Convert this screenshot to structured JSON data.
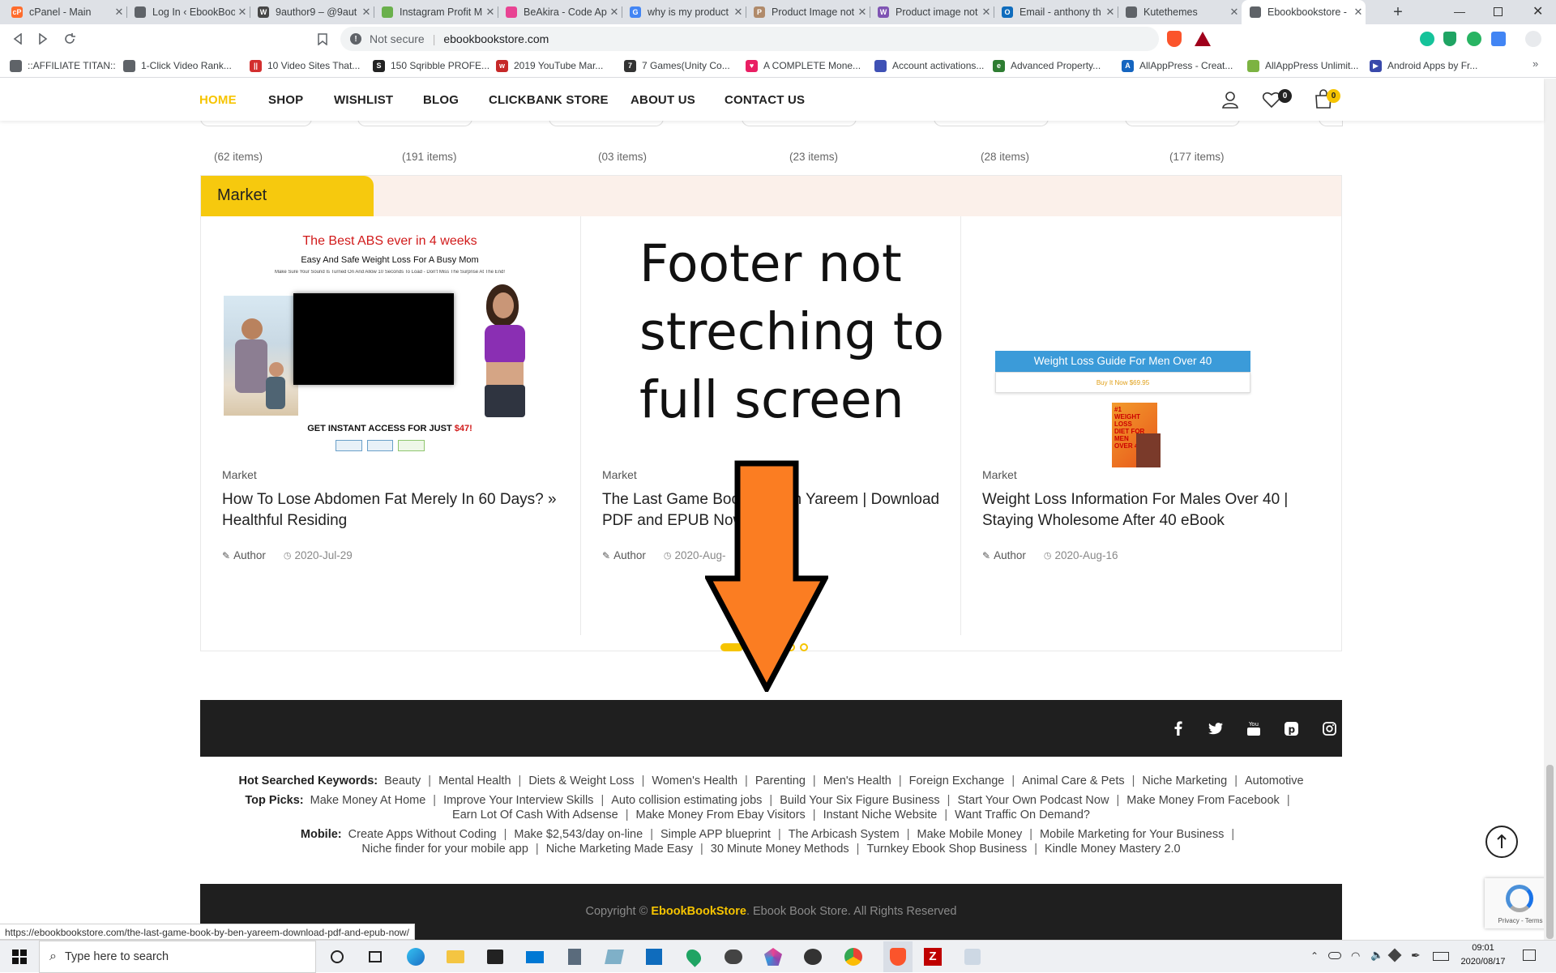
{
  "browser": {
    "tabs": [
      {
        "label": "cPanel - Main",
        "icon": "cpanel-icon",
        "color": "#ff6c2c",
        "glyph": "cP"
      },
      {
        "label": "Log In ‹ EbookBoo",
        "icon": "globe-icon",
        "color": "#5f6368",
        "glyph": ""
      },
      {
        "label": "9author9 – @9aut",
        "icon": "wordpress-icon",
        "color": "#464646",
        "glyph": "W"
      },
      {
        "label": "Instagram Profit M",
        "icon": "plant-icon",
        "color": "#6ab04c",
        "glyph": ""
      },
      {
        "label": "BeAkira - Code Ap",
        "icon": "color-wheel-icon",
        "color": "#e84393",
        "glyph": ""
      },
      {
        "label": "why is my product",
        "icon": "google-icon",
        "color": "#4285f4",
        "glyph": "G"
      },
      {
        "label": "Product Image not",
        "icon": "p-logo-icon",
        "color": "#b08a6a",
        "glyph": "P"
      },
      {
        "label": "Product image not",
        "icon": "woo-icon",
        "color": "#7f54b3",
        "glyph": "W"
      },
      {
        "label": "Email - anthony th",
        "icon": "outlook-icon",
        "color": "#0f6cbd",
        "glyph": "O"
      },
      {
        "label": "Kutethemes",
        "icon": "globe-icon",
        "color": "#5f6368",
        "glyph": ""
      },
      {
        "label": "Ebookbookstore -",
        "icon": "globe-icon",
        "color": "#5f6368",
        "glyph": ""
      }
    ],
    "security": "Not secure",
    "url": "ebookbookstore.com",
    "bookmarks": [
      {
        "label": "::AFFILIATE TITAN::",
        "icon": "globe-icon",
        "color": "#5f6368",
        "glyph": ""
      },
      {
        "label": "1-Click Video Rank...",
        "icon": "globe-icon",
        "color": "#5f6368",
        "glyph": ""
      },
      {
        "label": "10 Video Sites That...",
        "icon": "red-square-icon",
        "color": "#d32f2f",
        "glyph": "||"
      },
      {
        "label": "150 Sqribble PROFE...",
        "icon": "s-logo-icon",
        "color": "#222",
        "glyph": "S"
      },
      {
        "label": "2019 YouTube Mar...",
        "icon": "wp-icon",
        "color": "#c62828",
        "glyph": "w"
      },
      {
        "label": "7 Games(Unity Co...",
        "icon": "unity-icon",
        "color": "#333",
        "glyph": "7"
      },
      {
        "label": "A COMPLETE Mone...",
        "icon": "heart-icon",
        "color": "#e91e63",
        "glyph": "♥"
      },
      {
        "label": "Account activations...",
        "icon": "bottle-icon",
        "color": "#3f51b5",
        "glyph": ""
      },
      {
        "label": "Advanced Property...",
        "icon": "e-logo-icon",
        "color": "#2e7d32",
        "glyph": "e"
      },
      {
        "label": "AllAppPress - Creat...",
        "icon": "a-logo-icon",
        "color": "#1565c0",
        "glyph": "A"
      },
      {
        "label": "AllAppPress Unlimit...",
        "icon": "green-doc-icon",
        "color": "#7cb342",
        "glyph": ""
      },
      {
        "label": "Android Apps by Fr...",
        "icon": "play-store-icon",
        "color": "#3949ab",
        "glyph": "▶"
      }
    ],
    "status_url": "https://ebookbookstore.com/the-last-game-book-by-ben-yareem-download-pdf-and-epub-now/"
  },
  "site": {
    "menu": [
      "HOME",
      "SHOP",
      "WISHLIST",
      "BLOG",
      "CLICKBANK STORE",
      "ABOUT US",
      "CONTACT US"
    ],
    "wishlist_count": "0",
    "cart_count": "0",
    "category_counts": [
      "(62 items)",
      "(191 items)",
      "(03 items)",
      "(23 items)",
      "(28 items)",
      "(177 items)"
    ],
    "section_title": "Market",
    "posts": [
      {
        "category": "Market",
        "title": "How To Lose Abdomen Fat Merely In 60 Days? » Healthful Residing",
        "author": "Author",
        "date": "2020-Jul-29",
        "image": {
          "headline": "The Best ABS ever in 4 weeks",
          "subhead": "Easy And Safe Weight Loss For A Busy Mom",
          "fine": "Make Sure Your Sound Is Turned On And Allow 10 Seconds To Load - Don't Miss The Surprise At The End!",
          "cta": "GET INSTANT ACCESS FOR JUST",
          "price": "$47!"
        }
      },
      {
        "category": "Market",
        "title": "The Last Game Book By Ben Yareem | Download PDF and EPUB Now",
        "author": "Author",
        "date": "2020-Aug-",
        "image": null
      },
      {
        "category": "Market",
        "title": "Weight Loss Information For Males Over 40 | Staying Wholesome After 40 eBook",
        "author": "Author",
        "date": "2020-Aug-16",
        "image": {
          "banner": "Weight Loss Guide For Men Over 40",
          "buy": "Buy It Now $69.95",
          "cover": "#1 WEIGHT LOSS DIET FOR MEN OVER 40"
        }
      }
    ],
    "slider_dots": 6,
    "slider_active": 0,
    "social": [
      "facebook-icon",
      "twitter-icon",
      "youtube-icon",
      "pinterest-icon",
      "instagram-icon"
    ],
    "hot_label": "Hot Searched Keywords:",
    "hot_keywords": [
      "Beauty",
      "Mental Health",
      "Diets & Weight Loss",
      "Women's Health",
      "Parenting",
      "Men's Health",
      "Foreign Exchange",
      "Animal Care & Pets",
      "Niche Marketing",
      "Automotive"
    ],
    "top_label": "Top Picks:",
    "top_picks_line1": [
      "Make Money At Home",
      "Improve Your Interview Skills",
      "Auto collision estimating jobs",
      "Build Your Six Figure Business",
      "Start Your Own Podcast Now",
      "Make Money From Facebook"
    ],
    "top_picks_line2": [
      "Earn Lot Of Cash With Adsense",
      "Make Money From Ebay Visitors",
      "Instant Niche Website",
      "Want Traffic On Demand?"
    ],
    "mobile_label": "Mobile:",
    "mobile_line1": [
      "Create Apps Without Coding",
      "Make $2,543/day on-line",
      "Simple APP blueprint",
      "The Arbicash System",
      "Make Mobile Money",
      "Mobile Marketing for Your Business"
    ],
    "mobile_line2": [
      "Niche finder for your mobile app",
      "Niche Marketing Made Easy",
      "30 Minute Money Methods",
      "Turnkey Ebook Shop Business",
      "Kindle Money Mastery 2.0"
    ],
    "copyright_prefix": "Copyright ©",
    "copyright_brand": "EbookBookStore",
    "copyright_suffix": ". Ebook Book Store. All Rights Reserved",
    "recaptcha_links": "Privacy - Terms"
  },
  "annotation": {
    "lines": [
      "Footer not",
      "streching to",
      "full screen"
    ],
    "arrow_color": "#fb7d22"
  },
  "taskbar": {
    "search_placeholder": "Type here to search",
    "time": "09:01",
    "date": "2020/08/17"
  },
  "colors": {
    "accent": "#f6c400",
    "dark_footer": "#1f1f1f",
    "section_bg": "#fbf0ea"
  }
}
